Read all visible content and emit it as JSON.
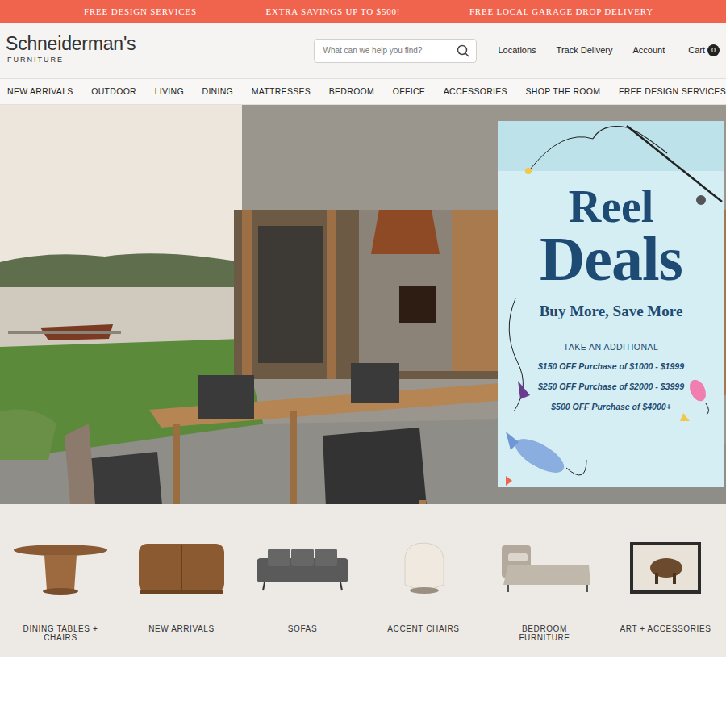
{
  "promo_bar": [
    "FREE DESIGN SERVICES",
    "EXTRA SAVINGS UP TO $500!",
    "FREE LOCAL GARAGE DROP DELIVERY"
  ],
  "logo": {
    "name": "Schneiderman's",
    "tagline": "FURNITURE"
  },
  "search": {
    "placeholder": "What can we help you find?"
  },
  "header_links": [
    "Locations",
    "Track Delivery",
    "Account"
  ],
  "cart": {
    "label": "Cart",
    "count": "0"
  },
  "nav": [
    "NEW ARRIVALS",
    "OUTDOOR",
    "LIVING",
    "DINING",
    "MATTRESSES",
    "BEDROOM",
    "OFFICE",
    "ACCESSORIES",
    "SHOP THE ROOM",
    "FREE DESIGN SERVICES"
  ],
  "hero": {
    "promo": {
      "title_line1": "Reel",
      "title_line2": "Deals",
      "subtitle": "Buy More, Save More",
      "lead": "TAKE AN ADDITIONAL",
      "offers": [
        "$150 OFF Purchase of $1000 - $1999",
        "$250 OFF Purchase of $2000 - $3999",
        "$500 OFF Purchase of $4000+"
      ]
    }
  },
  "categories": [
    {
      "label": "DINING TABLES + CHAIRS",
      "kind": "table"
    },
    {
      "label": "NEW ARRIVALS",
      "kind": "cabinet"
    },
    {
      "label": "SOFAS",
      "kind": "sofa"
    },
    {
      "label": "ACCENT CHAIRS",
      "kind": "chair"
    },
    {
      "label": "BEDROOM FURNITURE",
      "kind": "bed"
    },
    {
      "label": "ART + ACCESSORIES",
      "kind": "art"
    }
  ]
}
